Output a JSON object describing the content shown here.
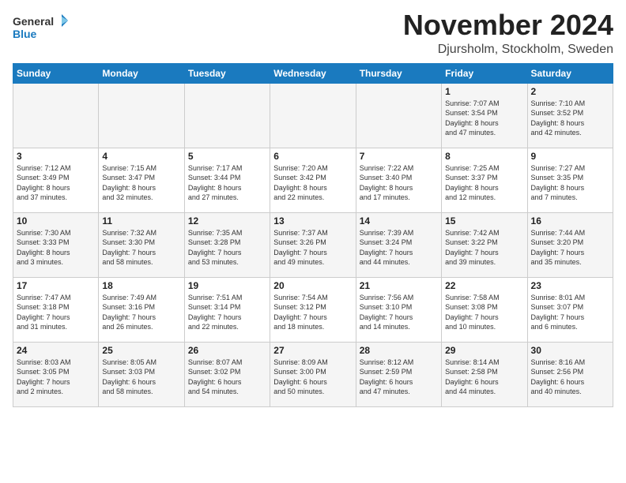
{
  "header": {
    "logo_line1": "General",
    "logo_line2": "Blue",
    "month_title": "November 2024",
    "location": "Djursholm, Stockholm, Sweden"
  },
  "weekdays": [
    "Sunday",
    "Monday",
    "Tuesday",
    "Wednesday",
    "Thursday",
    "Friday",
    "Saturday"
  ],
  "weeks": [
    [
      {
        "day": "",
        "info": ""
      },
      {
        "day": "",
        "info": ""
      },
      {
        "day": "",
        "info": ""
      },
      {
        "day": "",
        "info": ""
      },
      {
        "day": "",
        "info": ""
      },
      {
        "day": "1",
        "info": "Sunrise: 7:07 AM\nSunset: 3:54 PM\nDaylight: 8 hours\nand 47 minutes."
      },
      {
        "day": "2",
        "info": "Sunrise: 7:10 AM\nSunset: 3:52 PM\nDaylight: 8 hours\nand 42 minutes."
      }
    ],
    [
      {
        "day": "3",
        "info": "Sunrise: 7:12 AM\nSunset: 3:49 PM\nDaylight: 8 hours\nand 37 minutes."
      },
      {
        "day": "4",
        "info": "Sunrise: 7:15 AM\nSunset: 3:47 PM\nDaylight: 8 hours\nand 32 minutes."
      },
      {
        "day": "5",
        "info": "Sunrise: 7:17 AM\nSunset: 3:44 PM\nDaylight: 8 hours\nand 27 minutes."
      },
      {
        "day": "6",
        "info": "Sunrise: 7:20 AM\nSunset: 3:42 PM\nDaylight: 8 hours\nand 22 minutes."
      },
      {
        "day": "7",
        "info": "Sunrise: 7:22 AM\nSunset: 3:40 PM\nDaylight: 8 hours\nand 17 minutes."
      },
      {
        "day": "8",
        "info": "Sunrise: 7:25 AM\nSunset: 3:37 PM\nDaylight: 8 hours\nand 12 minutes."
      },
      {
        "day": "9",
        "info": "Sunrise: 7:27 AM\nSunset: 3:35 PM\nDaylight: 8 hours\nand 7 minutes."
      }
    ],
    [
      {
        "day": "10",
        "info": "Sunrise: 7:30 AM\nSunset: 3:33 PM\nDaylight: 8 hours\nand 3 minutes."
      },
      {
        "day": "11",
        "info": "Sunrise: 7:32 AM\nSunset: 3:30 PM\nDaylight: 7 hours\nand 58 minutes."
      },
      {
        "day": "12",
        "info": "Sunrise: 7:35 AM\nSunset: 3:28 PM\nDaylight: 7 hours\nand 53 minutes."
      },
      {
        "day": "13",
        "info": "Sunrise: 7:37 AM\nSunset: 3:26 PM\nDaylight: 7 hours\nand 49 minutes."
      },
      {
        "day": "14",
        "info": "Sunrise: 7:39 AM\nSunset: 3:24 PM\nDaylight: 7 hours\nand 44 minutes."
      },
      {
        "day": "15",
        "info": "Sunrise: 7:42 AM\nSunset: 3:22 PM\nDaylight: 7 hours\nand 39 minutes."
      },
      {
        "day": "16",
        "info": "Sunrise: 7:44 AM\nSunset: 3:20 PM\nDaylight: 7 hours\nand 35 minutes."
      }
    ],
    [
      {
        "day": "17",
        "info": "Sunrise: 7:47 AM\nSunset: 3:18 PM\nDaylight: 7 hours\nand 31 minutes."
      },
      {
        "day": "18",
        "info": "Sunrise: 7:49 AM\nSunset: 3:16 PM\nDaylight: 7 hours\nand 26 minutes."
      },
      {
        "day": "19",
        "info": "Sunrise: 7:51 AM\nSunset: 3:14 PM\nDaylight: 7 hours\nand 22 minutes."
      },
      {
        "day": "20",
        "info": "Sunrise: 7:54 AM\nSunset: 3:12 PM\nDaylight: 7 hours\nand 18 minutes."
      },
      {
        "day": "21",
        "info": "Sunrise: 7:56 AM\nSunset: 3:10 PM\nDaylight: 7 hours\nand 14 minutes."
      },
      {
        "day": "22",
        "info": "Sunrise: 7:58 AM\nSunset: 3:08 PM\nDaylight: 7 hours\nand 10 minutes."
      },
      {
        "day": "23",
        "info": "Sunrise: 8:01 AM\nSunset: 3:07 PM\nDaylight: 7 hours\nand 6 minutes."
      }
    ],
    [
      {
        "day": "24",
        "info": "Sunrise: 8:03 AM\nSunset: 3:05 PM\nDaylight: 7 hours\nand 2 minutes."
      },
      {
        "day": "25",
        "info": "Sunrise: 8:05 AM\nSunset: 3:03 PM\nDaylight: 6 hours\nand 58 minutes."
      },
      {
        "day": "26",
        "info": "Sunrise: 8:07 AM\nSunset: 3:02 PM\nDaylight: 6 hours\nand 54 minutes."
      },
      {
        "day": "27",
        "info": "Sunrise: 8:09 AM\nSunset: 3:00 PM\nDaylight: 6 hours\nand 50 minutes."
      },
      {
        "day": "28",
        "info": "Sunrise: 8:12 AM\nSunset: 2:59 PM\nDaylight: 6 hours\nand 47 minutes."
      },
      {
        "day": "29",
        "info": "Sunrise: 8:14 AM\nSunset: 2:58 PM\nDaylight: 6 hours\nand 44 minutes."
      },
      {
        "day": "30",
        "info": "Sunrise: 8:16 AM\nSunset: 2:56 PM\nDaylight: 6 hours\nand 40 minutes."
      }
    ]
  ]
}
